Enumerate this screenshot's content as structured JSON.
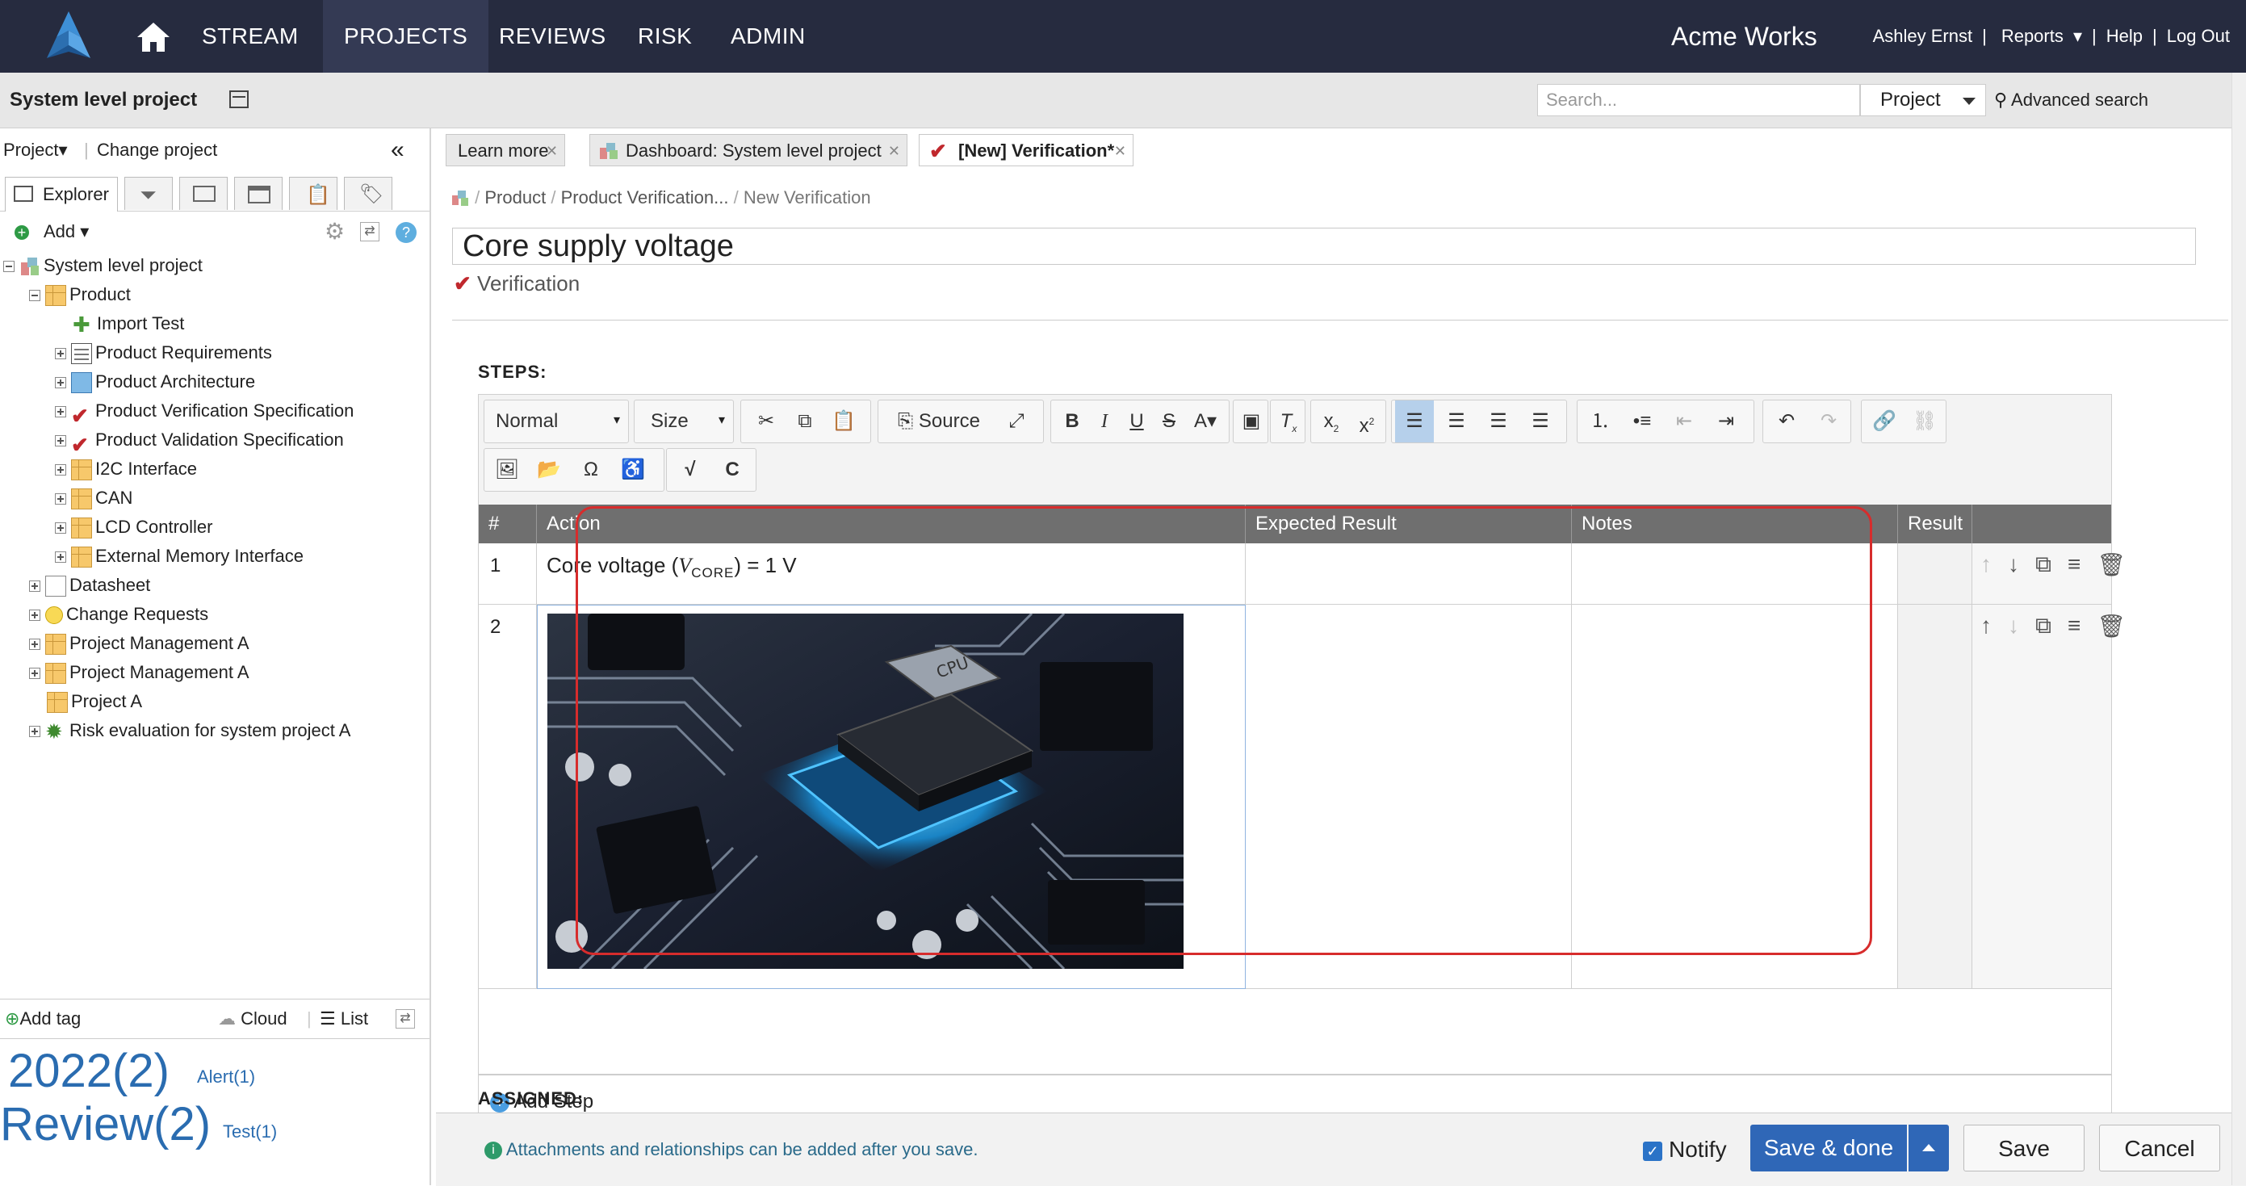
{
  "nav": {
    "items": [
      "STREAM",
      "PROJECTS",
      "REVIEWS",
      "RISK",
      "ADMIN"
    ],
    "brand": "Acme Works",
    "user": "Ashley Ernst",
    "reports": "Reports",
    "help": "Help",
    "logout": "Log Out"
  },
  "subheader": {
    "project_title": "System level project",
    "search_placeholder": "Search...",
    "scope": "Project",
    "advanced": "Advanced search"
  },
  "left": {
    "project_menu": "Project▾",
    "change_project": "Change project",
    "explorer_tab": "Explorer",
    "add": "Add",
    "tree": [
      {
        "label": "System level project",
        "level": 0,
        "icon": "project-icon",
        "toggle": "minus"
      },
      {
        "label": "Product",
        "level": 1,
        "icon": "component-icon",
        "toggle": "minus"
      },
      {
        "label": "Import Test",
        "level": 2,
        "icon": "puzzle-icon",
        "toggle": "none"
      },
      {
        "label": "Product Requirements",
        "level": 2,
        "icon": "requirements-icon",
        "toggle": "plus"
      },
      {
        "label": "Product Architecture",
        "level": 2,
        "icon": "architecture-icon",
        "toggle": "plus"
      },
      {
        "label": "Product Verification Specification",
        "level": 2,
        "icon": "verification-icon",
        "toggle": "plus"
      },
      {
        "label": "Product Validation Specification",
        "level": 2,
        "icon": "validation-icon",
        "toggle": "plus"
      },
      {
        "label": "I2C Interface",
        "level": 2,
        "icon": "component-icon",
        "toggle": "plus"
      },
      {
        "label": "CAN",
        "level": 2,
        "icon": "component-icon",
        "toggle": "plus"
      },
      {
        "label": "LCD Controller",
        "level": 2,
        "icon": "component-icon",
        "toggle": "plus"
      },
      {
        "label": "External Memory Interface",
        "level": 2,
        "icon": "component-icon",
        "toggle": "plus"
      },
      {
        "label": "Datasheet",
        "level": 1,
        "icon": "document-icon",
        "toggle": "plus"
      },
      {
        "label": "Change Requests",
        "level": 1,
        "icon": "lightbulb-icon",
        "toggle": "plus"
      },
      {
        "label": "Project Management A",
        "level": 1,
        "icon": "component-icon",
        "toggle": "plus"
      },
      {
        "label": "Project Management A",
        "level": 1,
        "icon": "component-icon",
        "toggle": "plus"
      },
      {
        "label": "Project A",
        "level": 1,
        "icon": "component-icon",
        "toggle": "none"
      },
      {
        "label": "Risk evaluation for system project A",
        "level": 1,
        "icon": "risk-icon",
        "toggle": "plus"
      }
    ],
    "tags_header": {
      "add_tag": "Add tag",
      "cloud": "Cloud",
      "list": "List"
    },
    "tags": {
      "t2022": "2022(2)",
      "alert": "Alert(1)",
      "review": "Review(2)",
      "test": "Test(1)"
    }
  },
  "doc_tabs": [
    {
      "label": "Learn more"
    },
    {
      "label": "Dashboard: System level project"
    },
    {
      "label": "[New] Verification*"
    }
  ],
  "main": {
    "crumbs": {
      "product": "Product",
      "spec": "Product Verification...",
      "current": "New Verification"
    },
    "title": "Core supply voltage",
    "type": "Verification",
    "steps_label": "STEPS:",
    "toolbar": {
      "format": "Normal",
      "size": "Size",
      "source": "Source"
    },
    "columns": [
      "#",
      "Action",
      "Expected Result",
      "Notes",
      "Result"
    ],
    "rows": [
      {
        "num": "1",
        "action_pre": "Core voltage (",
        "v": "V",
        "sub": "CORE",
        "action_post": ") = 1 V"
      },
      {
        "num": "2",
        "image": "cpu-chip-on-circuit-board"
      }
    ],
    "add_step": "Add Step",
    "assigned_label": "ASSIGNED:"
  },
  "footer": {
    "info": "Attachments and relationships can be added after you save.",
    "notify": "Notify",
    "save_done": "Save & done",
    "save": "Save",
    "cancel": "Cancel"
  }
}
